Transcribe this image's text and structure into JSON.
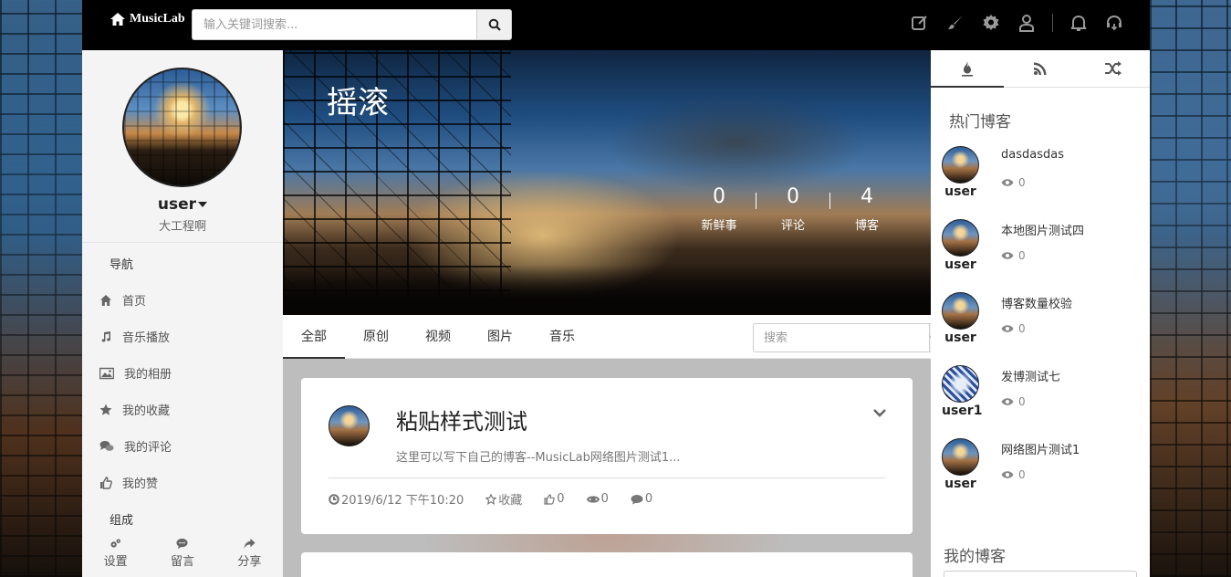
{
  "navbar": {
    "brand": "MusicLab",
    "search_placeholder": "输入关键词搜索...",
    "icons": [
      "edit-icon",
      "brush-icon",
      "gear-icon",
      "user-icon",
      "bell-icon",
      "headphones-icon"
    ]
  },
  "sidebar": {
    "username": "user",
    "motto": "大工程啊",
    "nav_heading": "导航",
    "items": [
      {
        "label": "首页",
        "icon": "home-icon"
      },
      {
        "label": "音乐播放",
        "icon": "music-icon"
      },
      {
        "label": "我的相册",
        "icon": "image-icon"
      },
      {
        "label": "我的收藏",
        "icon": "star-icon"
      },
      {
        "label": "我的评论",
        "icon": "comments-icon"
      },
      {
        "label": "我的赞",
        "icon": "thumbs-up-icon"
      }
    ],
    "group_heading": "组成",
    "bottom": [
      {
        "label": "设置",
        "icon": "cogs-icon"
      },
      {
        "label": "留言",
        "icon": "comment-icon"
      },
      {
        "label": "分享",
        "icon": "share-icon"
      }
    ]
  },
  "banner": {
    "title": "摇滚",
    "stats": [
      {
        "value": "0",
        "label": "新鲜事"
      },
      {
        "value": "0",
        "label": "评论"
      },
      {
        "value": "4",
        "label": "博客"
      }
    ]
  },
  "tabs": {
    "items": [
      "全部",
      "原创",
      "视频",
      "图片",
      "音乐"
    ],
    "active": "全部",
    "search_placeholder": "搜索"
  },
  "post": {
    "title": "粘贴样式测试",
    "excerpt": "这里可以写下自己的博客--MusicLab网络图片测试1...",
    "date": "2019/6/12 下午10:20",
    "favorite": "收藏",
    "likes": "0",
    "views": "0",
    "comments": "0"
  },
  "right": {
    "tabs": [
      "fire-icon",
      "rss-icon",
      "random-icon"
    ],
    "hot_heading": "热门博客",
    "hot_blogs": [
      {
        "user": "user",
        "title": "dasdasdas",
        "views": "0"
      },
      {
        "user": "user",
        "title": "本地图片测试四",
        "views": "0"
      },
      {
        "user": "user",
        "title": "博客数量校验",
        "views": "0"
      },
      {
        "user": "user1",
        "title": "发博测试七",
        "views": "0"
      },
      {
        "user": "user",
        "title": "网络图片测试1",
        "views": "0"
      }
    ],
    "my_heading": "我的博客"
  }
}
